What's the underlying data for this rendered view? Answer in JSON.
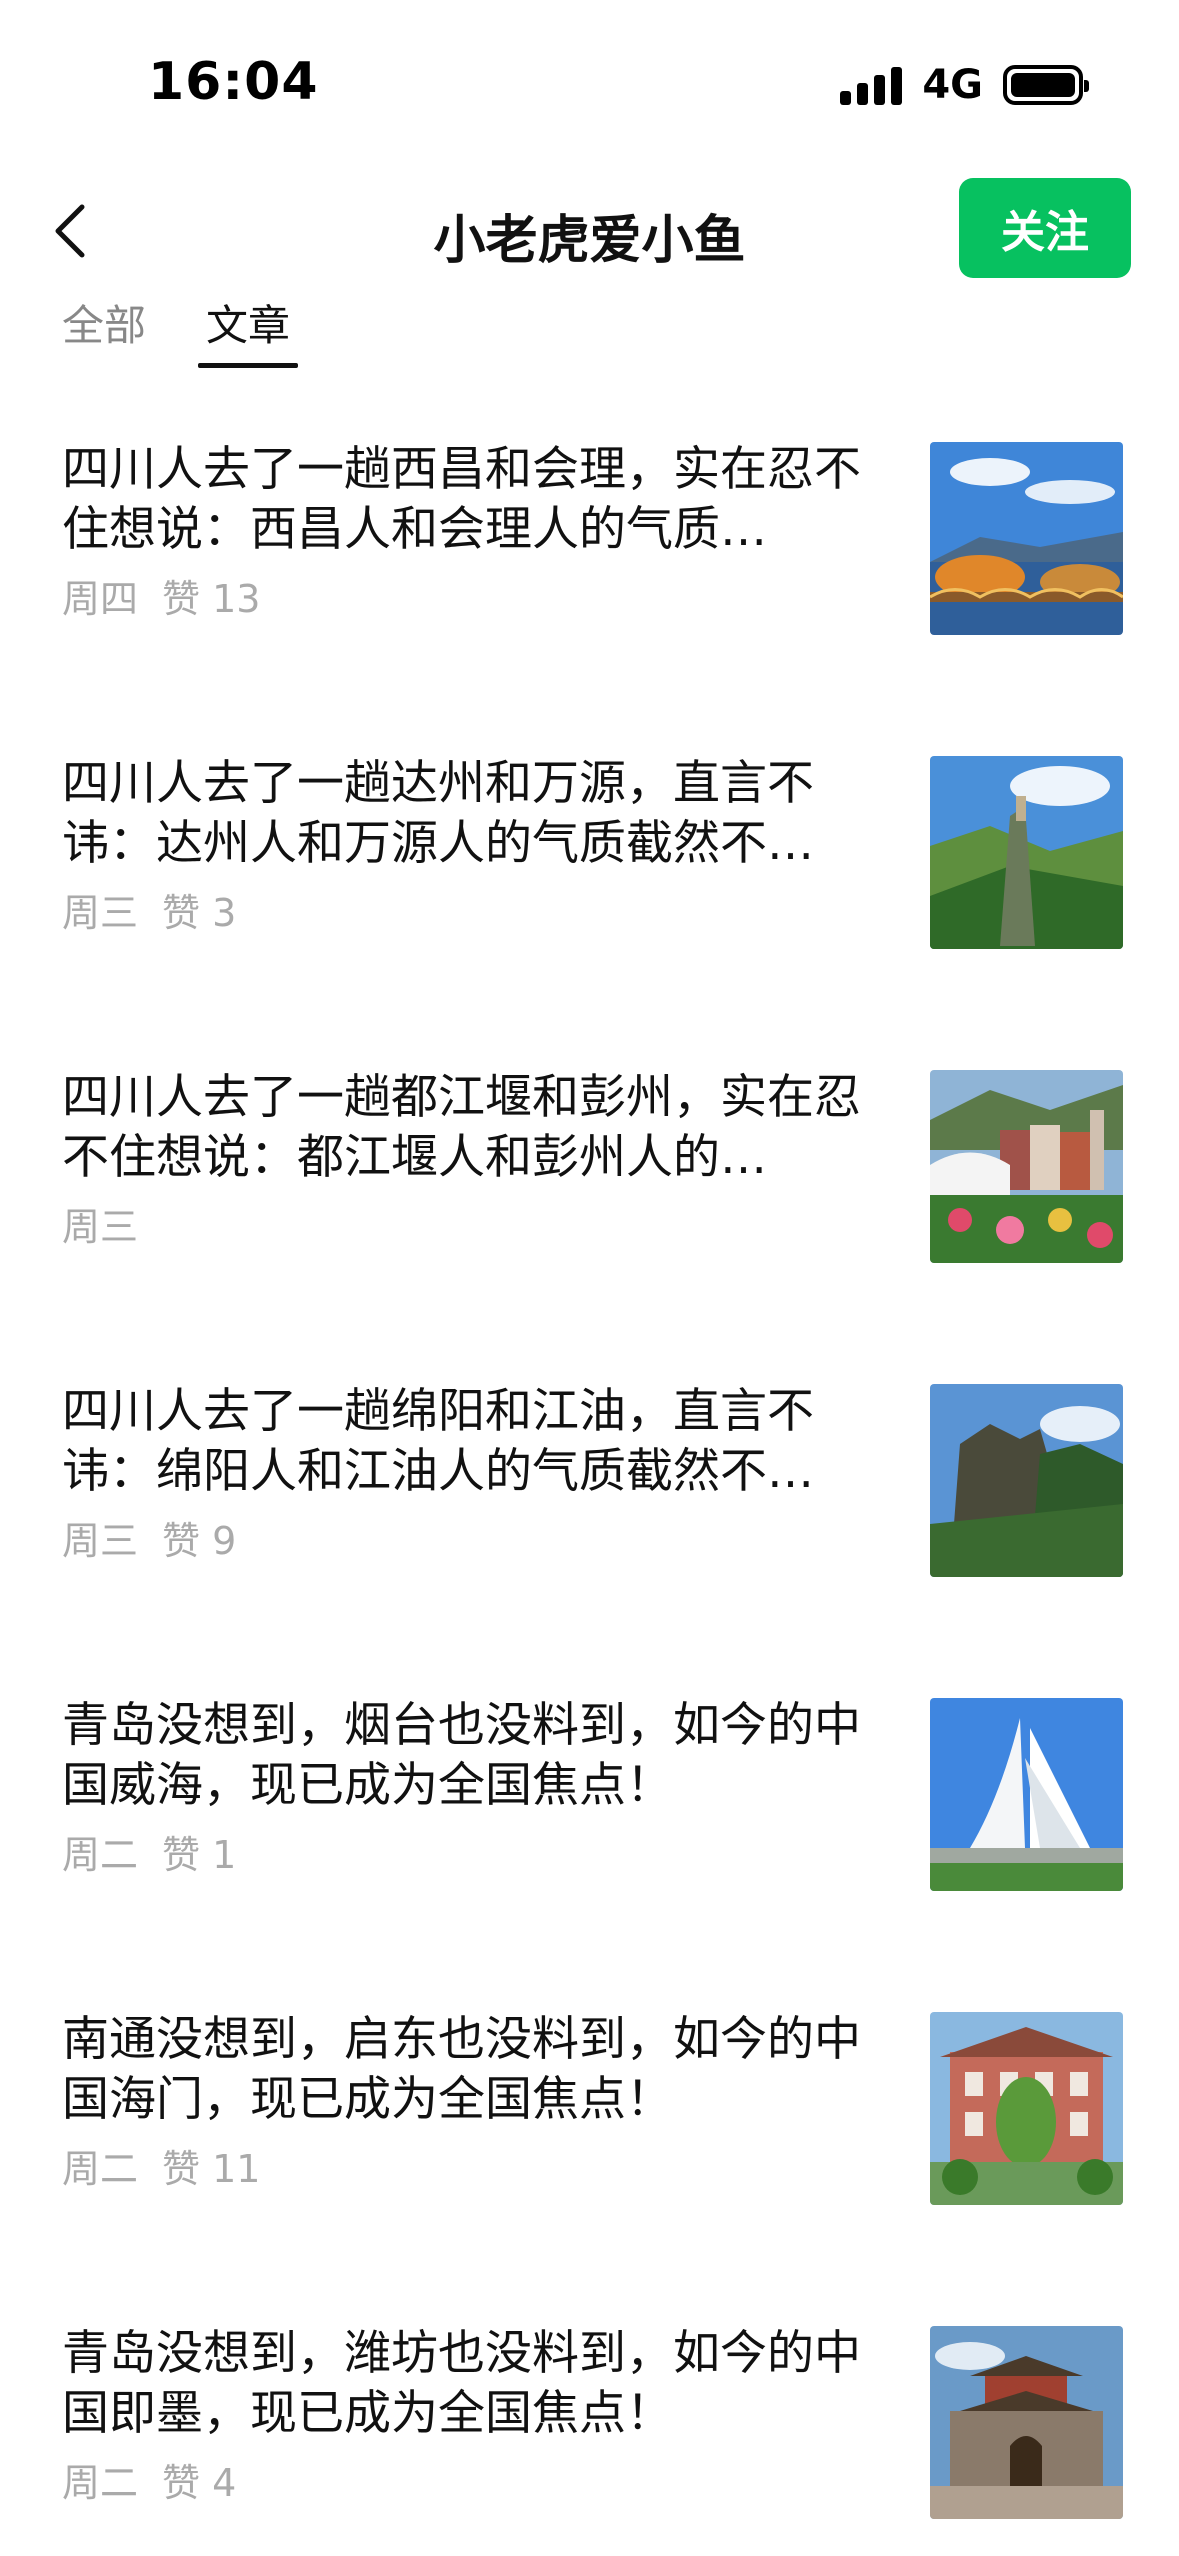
{
  "status_bar": {
    "time": "16:04",
    "network": "4G",
    "icons": [
      "signal-icon",
      "battery-icon"
    ]
  },
  "header": {
    "title": "小老虎爱小鱼",
    "follow_label": "关注",
    "back_icon": "chevron-left-icon",
    "accent_color": "#07c160"
  },
  "tabs": [
    {
      "label": "全部",
      "active": false
    },
    {
      "label": "文章",
      "active": true
    }
  ],
  "articles": [
    {
      "title": "四川人去了一趟西昌和会理，实在忍不住想说：西昌人和会理人的气质…",
      "day": "周四",
      "likes": "赞 13",
      "thumb": "lake-bridge-image"
    },
    {
      "title": "四川人去了一趟达州和万源，直言不讳：达州人和万源人的气质截然不…",
      "day": "周三",
      "likes": "赞 3",
      "thumb": "mountain-valley-image"
    },
    {
      "title": "四川人去了一趟都江堰和彭州，实在忍不住想说：都江堰人和彭州人的…",
      "day": "周三",
      "likes": "",
      "thumb": "town-flowers-image"
    },
    {
      "title": "四川人去了一趟绵阳和江油，直言不讳：绵阳人和江油人的气质截然不…",
      "day": "周三",
      "likes": "赞 9",
      "thumb": "rock-peak-image"
    },
    {
      "title": "青岛没想到，烟台也没料到，如今的中国威海，现已成为全国焦点！",
      "day": "周二",
      "likes": "赞 1",
      "thumb": "sail-sculpture-image"
    },
    {
      "title": "南通没想到，启东也没料到，如今的中国海门，现已成为全国焦点！",
      "day": "周二",
      "likes": "赞 11",
      "thumb": "historic-building-image"
    },
    {
      "title": "青岛没想到，潍坊也没料到，如今的中国即墨，现已成为全国焦点！",
      "day": "周二",
      "likes": "赞 4",
      "thumb": "city-gate-image"
    }
  ]
}
